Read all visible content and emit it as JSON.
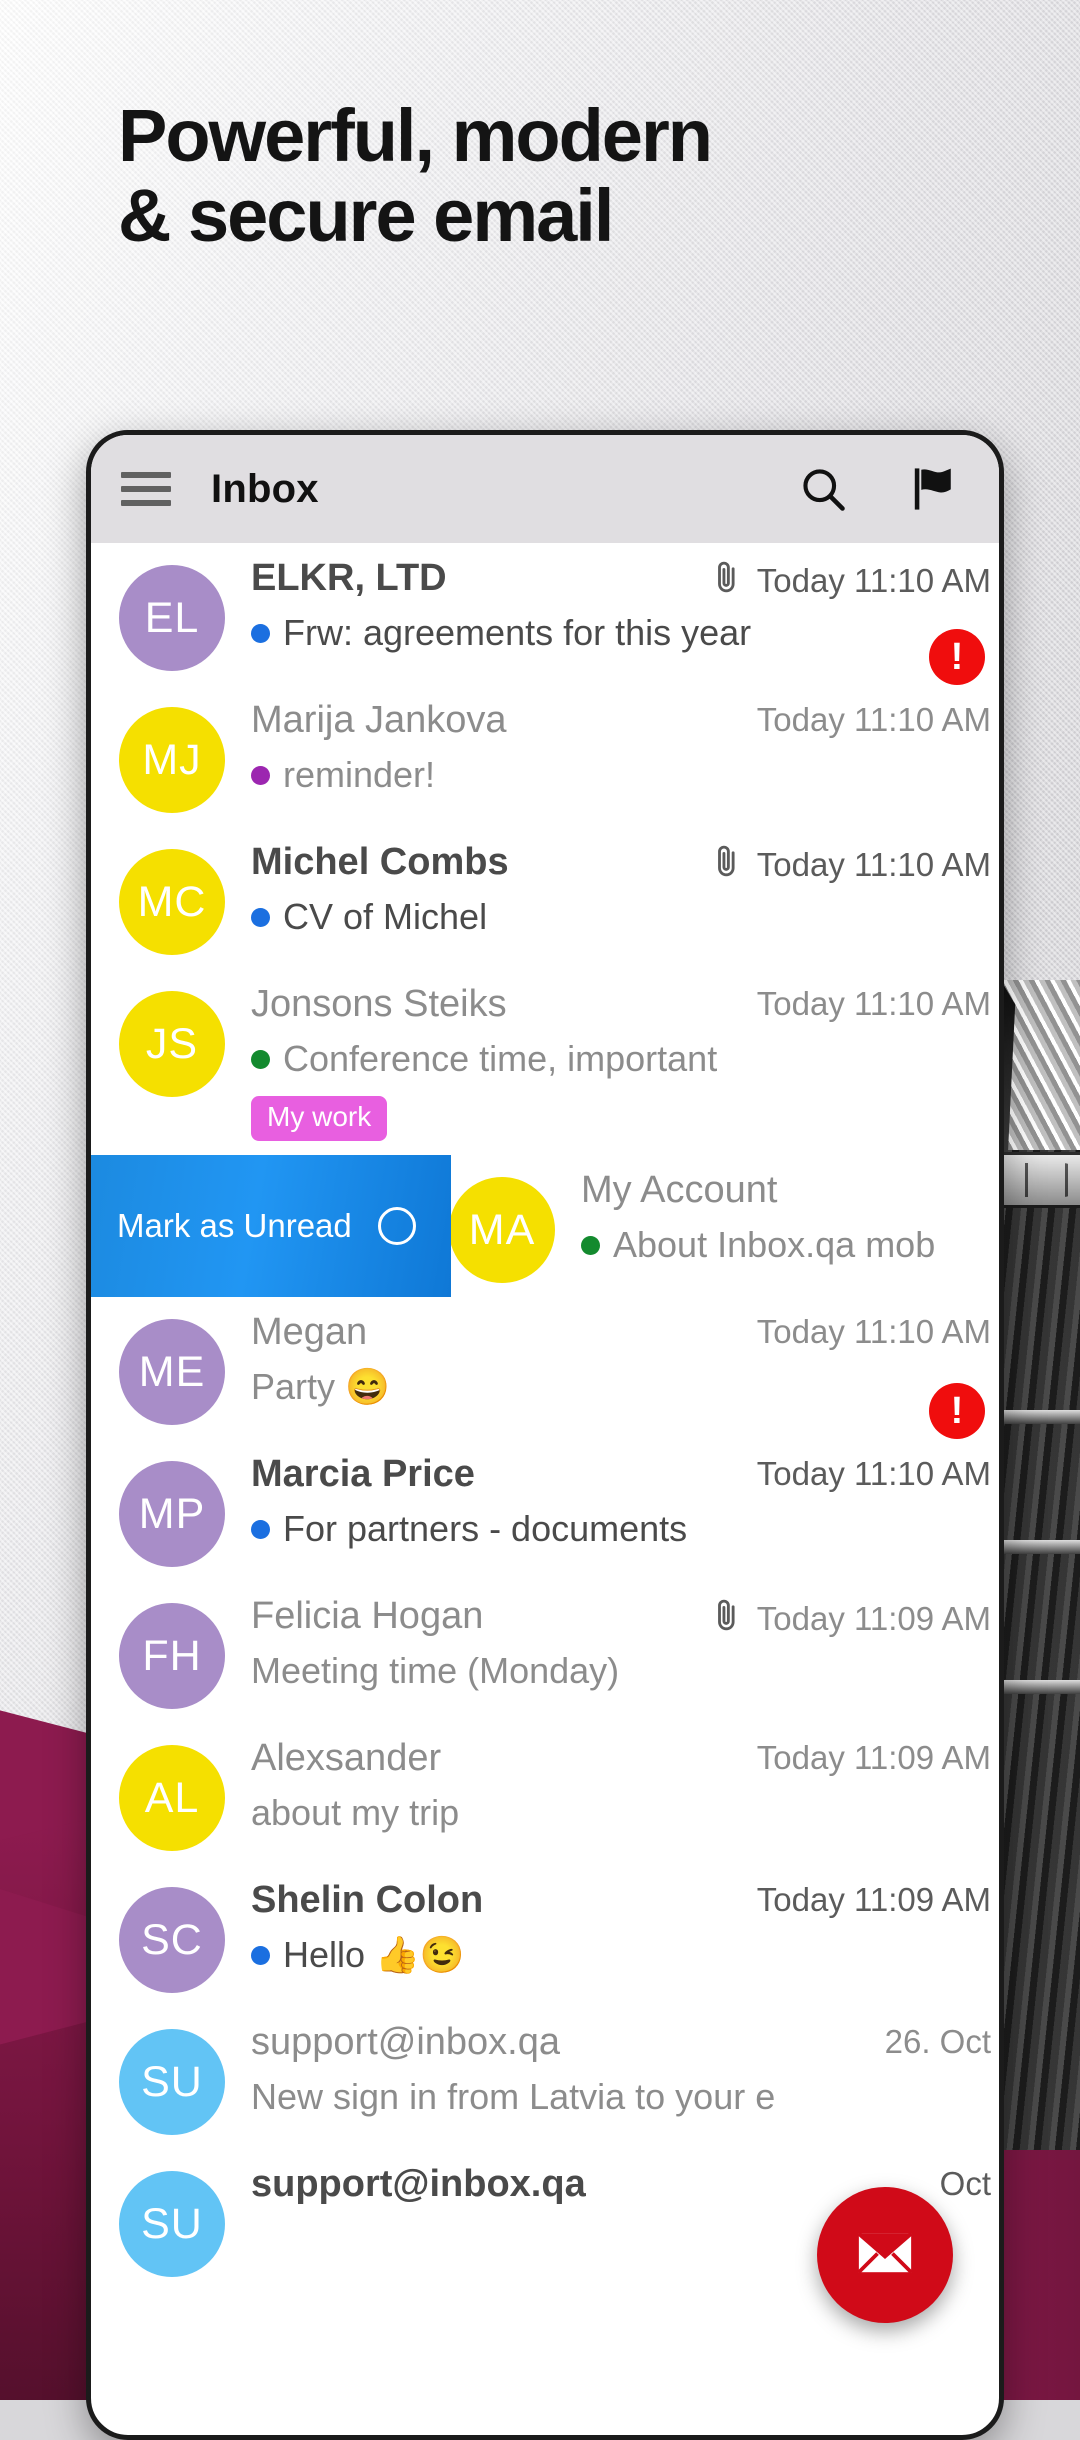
{
  "headline": {
    "line1": "Powerful, modern",
    "line2": "& secure email"
  },
  "toolbar": {
    "menu_icon": "hamburger-menu-icon",
    "title": "Inbox",
    "search_icon": "search-icon",
    "flag_icon": "flag-icon"
  },
  "swipe_action": {
    "label": "Mark as Unread",
    "icon": "circle-outline-icon"
  },
  "fab": {
    "icon": "envelope-icon",
    "color": "#d00a18"
  },
  "colors": {
    "avatar_purple": "#a88dc8",
    "avatar_yellow": "#f5e000",
    "avatar_blue": "#62c4f5",
    "dot_blue": "#1b6fe0",
    "dot_purple": "#9c26b0",
    "dot_green": "#138a2e",
    "tag_pink": "#e85fe0",
    "alert_red": "#f00d0d",
    "swipe_blue": "#2196f3",
    "toolbar_grey": "#e0dee1"
  },
  "emails": [
    {
      "initials": "EL",
      "avatar": "purple",
      "sender": "ELKR, LTD",
      "unread": true,
      "time": "Today 11:10 AM",
      "attachment": true,
      "dot": "blue",
      "subject": "Frw: agreements for this year",
      "alert": true,
      "tag": null
    },
    {
      "initials": "MJ",
      "avatar": "yellow",
      "sender": "Marija Jankova",
      "unread": false,
      "time": "Today 11:10 AM",
      "attachment": false,
      "dot": "purple",
      "subject": "reminder!",
      "alert": false,
      "tag": null
    },
    {
      "initials": "MC",
      "avatar": "yellow",
      "sender": "Michel Combs",
      "unread": true,
      "time": "Today 11:10 AM",
      "attachment": true,
      "dot": "blue",
      "subject": "CV of Michel",
      "alert": false,
      "tag": null
    },
    {
      "initials": "JS",
      "avatar": "yellow",
      "sender": "Jonsons Steiks",
      "unread": false,
      "time": "Today 11:10 AM",
      "attachment": false,
      "dot": "green",
      "subject": "Conference time, important",
      "alert": false,
      "tag": "My work"
    },
    {
      "initials": "MA",
      "avatar": "yellow",
      "sender": "My Account",
      "unread": false,
      "time": "",
      "attachment": false,
      "dot": "green",
      "subject": "About Inbox.qa mob",
      "alert": false,
      "tag": null,
      "swiped": true
    },
    {
      "initials": "ME",
      "avatar": "purple",
      "sender": "Megan",
      "unread": false,
      "time": "Today 11:10 AM",
      "attachment": false,
      "dot": "none",
      "subject": "Party 😄",
      "alert": true,
      "tag": null
    },
    {
      "initials": "MP",
      "avatar": "purple",
      "sender": "Marcia Price",
      "unread": true,
      "time": "Today 11:10 AM",
      "attachment": false,
      "dot": "blue",
      "subject": "For partners - documents",
      "alert": false,
      "tag": null
    },
    {
      "initials": "FH",
      "avatar": "purple",
      "sender": "Felicia Hogan",
      "unread": false,
      "time": "Today 11:09 AM",
      "attachment": true,
      "dot": "none",
      "subject": "Meeting time (Monday)",
      "alert": false,
      "tag": null
    },
    {
      "initials": "AL",
      "avatar": "yellow",
      "sender": "Alexsander",
      "unread": false,
      "time": "Today 11:09 AM",
      "attachment": false,
      "dot": "none",
      "subject": "about my trip",
      "alert": false,
      "tag": null
    },
    {
      "initials": "SC",
      "avatar": "purple",
      "sender": "Shelin Colon",
      "unread": true,
      "time": "Today 11:09 AM",
      "attachment": false,
      "dot": "blue",
      "subject": "Hello 👍😉",
      "alert": false,
      "tag": null
    },
    {
      "initials": "SU",
      "avatar": "blue",
      "sender": "support@inbox.qa",
      "unread": false,
      "time": "26. Oct",
      "attachment": false,
      "dot": "none",
      "subject": "New sign in from Latvia to your e",
      "alert": false,
      "tag": null
    },
    {
      "initials": "SU",
      "avatar": "blue",
      "sender": "support@inbox.qa",
      "unread": true,
      "time": "Oct",
      "attachment": false,
      "dot": "none",
      "subject": "",
      "alert": false,
      "tag": null
    }
  ]
}
